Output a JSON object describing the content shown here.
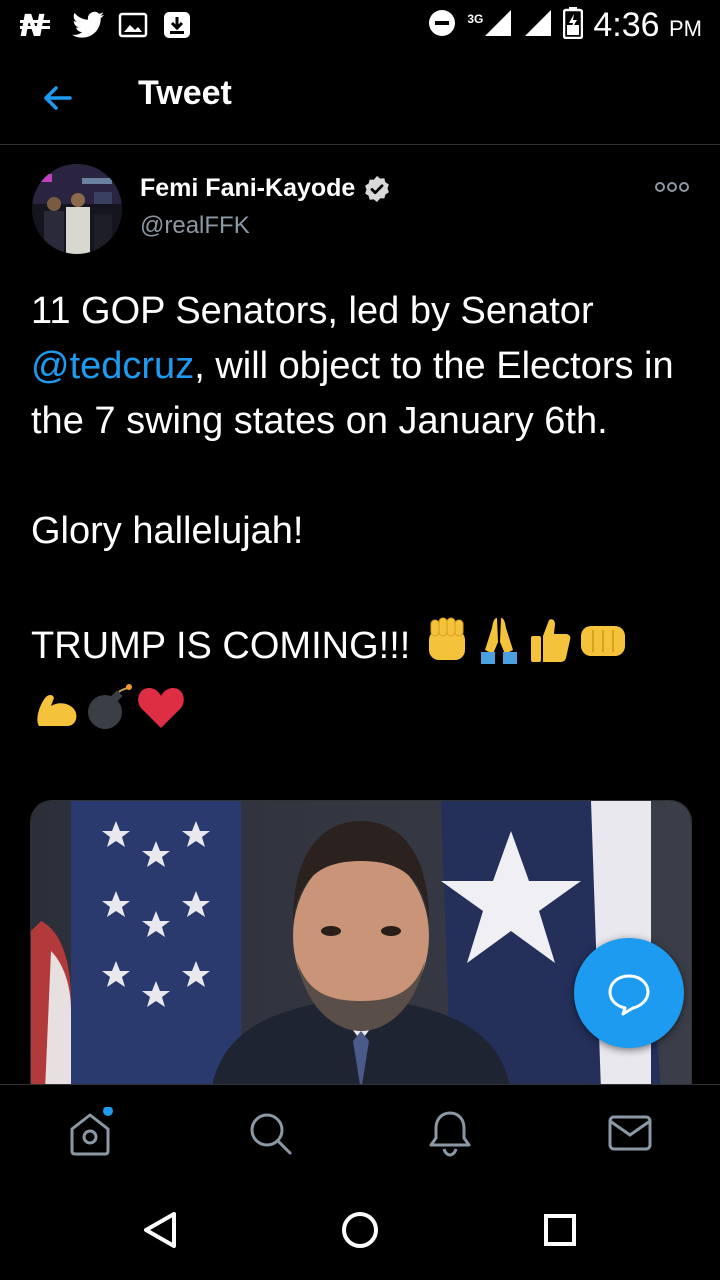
{
  "status_bar": {
    "time": "4:36",
    "period": "PM",
    "network": "3G",
    "icons": [
      "naira-icon",
      "twitter-bird-icon",
      "image-icon",
      "download-icon",
      "do-not-disturb-icon",
      "signal-icon",
      "signal-icon",
      "battery-icon"
    ]
  },
  "app_bar": {
    "title": "Tweet",
    "back_icon": "arrow-left-icon"
  },
  "tweet": {
    "author_name": "Femi Fani-Kayode",
    "verified": true,
    "handle": "@realFFK",
    "text": {
      "line1": "11 GOP Senators, led by Senator",
      "mention": "@tedcruz",
      "after_mention": ", will object to the Electors in the 7 swing states on January 6th.",
      "paragraph2": "Glory hallelujah!",
      "paragraph3": "TRUMP IS COMING!!!",
      "emojis": [
        "raised-fist",
        "folded-hands",
        "thumbs-up",
        "oncoming-fist",
        "flexed-biceps",
        "bomb",
        "red-heart"
      ]
    },
    "media_alt_icon": "photo-icon"
  },
  "fab": {
    "icon": "compose-reply-icon"
  },
  "bottom_nav": {
    "items": [
      "home-icon",
      "search-icon",
      "bell-icon",
      "mail-icon"
    ],
    "home_has_notification_dot": true
  },
  "system_nav": {
    "items": [
      "back-triangle-icon",
      "home-circle-icon",
      "recents-square-icon"
    ]
  },
  "colors": {
    "accent": "#1d9bf0",
    "background": "#000000",
    "secondary_text": "#8b98a5",
    "divider": "#2f3336"
  }
}
